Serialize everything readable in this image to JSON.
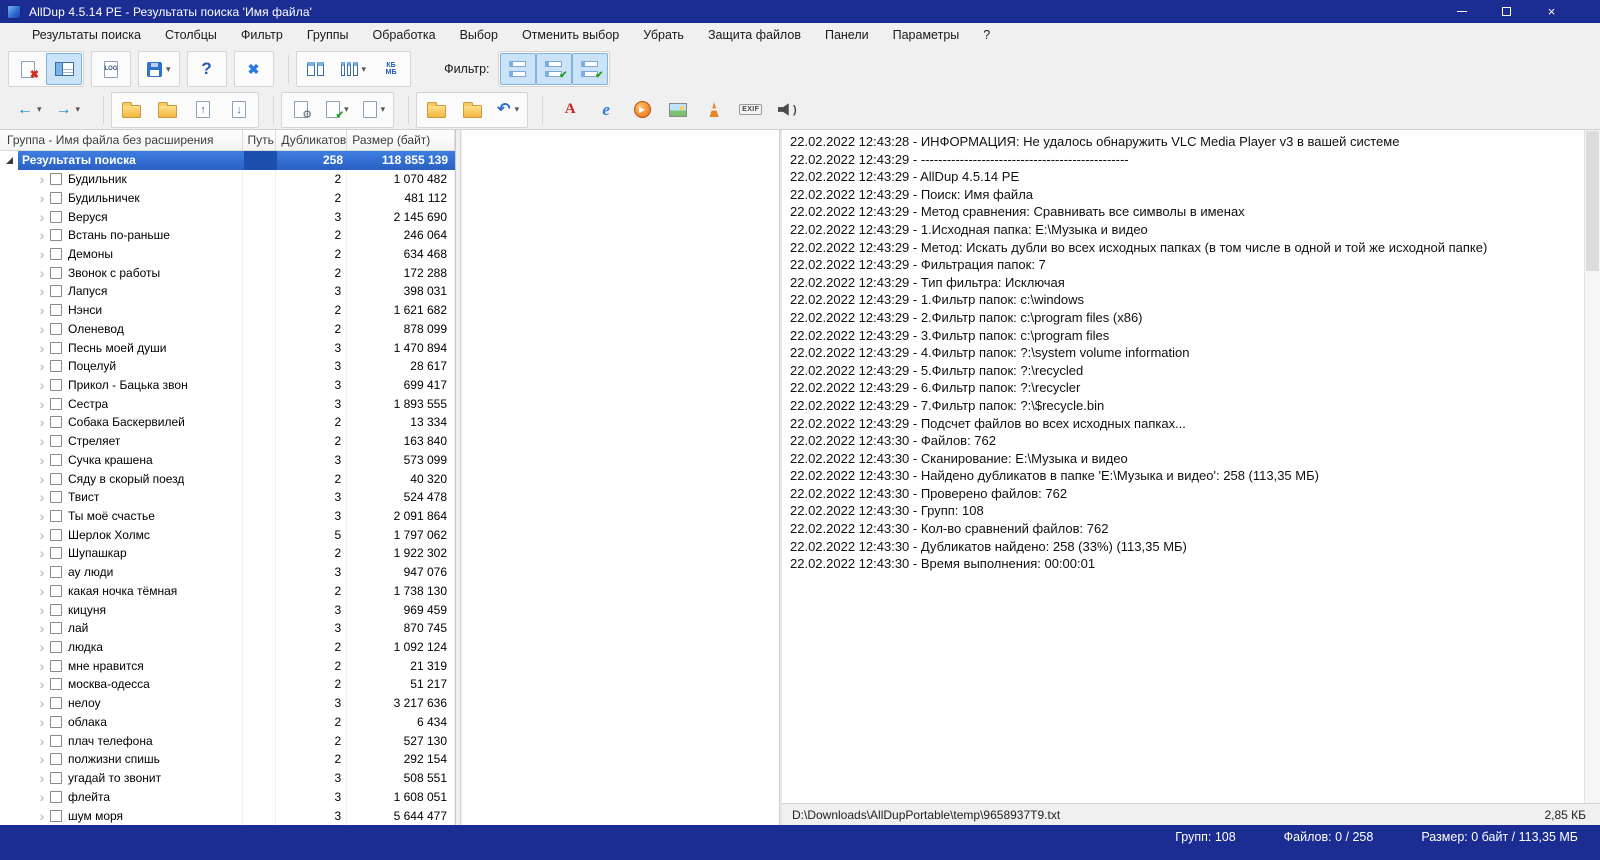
{
  "window": {
    "title": "AllDup 4.5.14 PE - Результаты поиска 'Имя файла'",
    "controls": {
      "close": "×"
    }
  },
  "menu": {
    "items": [
      "Результаты поиска",
      "Столбцы",
      "Фильтр",
      "Группы",
      "Обработка",
      "Выбор",
      "Отменить выбор",
      "Убрать",
      "Защита файлов",
      "Панели",
      "Параметры",
      "?"
    ]
  },
  "toolbar": {
    "filter_label": "Фильтр:"
  },
  "icons": {
    "dropdown": "▾",
    "red_x": "✖",
    "blue_x": "✖",
    "question": "?",
    "log": "LOG",
    "kb": "КБ",
    "mb": "МБ",
    "check": "✔",
    "gear": "⚙",
    "arrow_left": "←",
    "arrow_right": "→",
    "arrow_up": "↑",
    "arrow_down": "↓",
    "undo": "↶",
    "letter_a": "A",
    "letter_e": "e",
    "play": "▶",
    "exif": "EXIF",
    "wave": ")",
    "expander": "›"
  },
  "tree": {
    "columns": [
      "Группа - Имя файла без расширения",
      "Путь",
      "Дубликатов",
      "Размер (байт)"
    ],
    "root": {
      "label": "Результаты поиска",
      "duplicates": "258",
      "size": "118 855 139"
    },
    "rows": [
      {
        "label": "Будильник",
        "duplicates": "2",
        "size": "1 070 482"
      },
      {
        "label": "Будильничек",
        "duplicates": "2",
        "size": "481 112"
      },
      {
        "label": "Веруся",
        "duplicates": "3",
        "size": "2 145 690"
      },
      {
        "label": "Встань по-раньше",
        "duplicates": "2",
        "size": "246 064"
      },
      {
        "label": "Демоны",
        "duplicates": "2",
        "size": "634 468"
      },
      {
        "label": "Звонок с работы",
        "duplicates": "2",
        "size": "172 288"
      },
      {
        "label": "Лапуся",
        "duplicates": "3",
        "size": "398 031"
      },
      {
        "label": "Нэнси",
        "duplicates": "2",
        "size": "1 621 682"
      },
      {
        "label": "Оленевод",
        "duplicates": "2",
        "size": "878 099"
      },
      {
        "label": "Песнь моей души",
        "duplicates": "3",
        "size": "1 470 894"
      },
      {
        "label": "Поцелуй",
        "duplicates": "3",
        "size": "28 617"
      },
      {
        "label": "Прикол - Бацька звон",
        "duplicates": "3",
        "size": "699 417"
      },
      {
        "label": "Сестра",
        "duplicates": "3",
        "size": "1 893 555"
      },
      {
        "label": "Собака Баскервилей",
        "duplicates": "2",
        "size": "13 334"
      },
      {
        "label": "Стреляет",
        "duplicates": "2",
        "size": "163 840"
      },
      {
        "label": "Сучка крашена",
        "duplicates": "3",
        "size": "573 099"
      },
      {
        "label": "Сяду в скорый поезд",
        "duplicates": "2",
        "size": "40 320"
      },
      {
        "label": "Твист",
        "duplicates": "3",
        "size": "524 478"
      },
      {
        "label": "Ты моё счастье",
        "duplicates": "3",
        "size": "2 091 864"
      },
      {
        "label": "Шерлок Холмс",
        "duplicates": "5",
        "size": "1 797 062"
      },
      {
        "label": "Шупашкар",
        "duplicates": "2",
        "size": "1 922 302"
      },
      {
        "label": "ау люди",
        "duplicates": "3",
        "size": "947 076"
      },
      {
        "label": "какая ночка тёмная",
        "duplicates": "2",
        "size": "1 738 130"
      },
      {
        "label": "кицуня",
        "duplicates": "3",
        "size": "969 459"
      },
      {
        "label": "лай",
        "duplicates": "3",
        "size": "870 745"
      },
      {
        "label": "людка",
        "duplicates": "2",
        "size": "1 092 124"
      },
      {
        "label": "мне нравится",
        "duplicates": "2",
        "size": "21 319"
      },
      {
        "label": "москва-одесса",
        "duplicates": "2",
        "size": "51 217"
      },
      {
        "label": "нелоу",
        "duplicates": "3",
        "size": "3 217 636"
      },
      {
        "label": "облака",
        "duplicates": "2",
        "size": "6 434"
      },
      {
        "label": "плач телефона",
        "duplicates": "2",
        "size": "527 130"
      },
      {
        "label": "полжизни спишь",
        "duplicates": "2",
        "size": "292 154"
      },
      {
        "label": "угадай то звонит",
        "duplicates": "3",
        "size": "508 551"
      },
      {
        "label": "флейта",
        "duplicates": "3",
        "size": "1 608 051"
      },
      {
        "label": "шум моря",
        "duplicates": "3",
        "size": "5 644 477"
      }
    ]
  },
  "log": {
    "lines": [
      "22.02.2022 12:43:28 - ИНФОРМАЦИЯ: Не удалось обнаружить VLC Media Player v3 в вашей системе",
      "22.02.2022 12:43:29 - ------------------------------------------------",
      "22.02.2022 12:43:29 - AllDup 4.5.14 PE",
      "22.02.2022 12:43:29 - Поиск: Имя файла",
      "22.02.2022 12:43:29 - Метод сравнения: Сравнивать все символы в именах",
      "22.02.2022 12:43:29 - 1.Исходная папка: E:\\Музыка и видео",
      "22.02.2022 12:43:29 - Метод: Искать дубли во всех исходных папках (в том числе в одной и той же исходной папке)",
      "22.02.2022 12:43:29 - Фильтрация папок: 7",
      "22.02.2022 12:43:29 - Тип фильтра: Исключая",
      "22.02.2022 12:43:29 - 1.Фильтр папок: c:\\windows",
      "22.02.2022 12:43:29 - 2.Фильтр папок: c:\\program files (x86)",
      "22.02.2022 12:43:29 - 3.Фильтр папок: c:\\program files",
      "22.02.2022 12:43:29 - 4.Фильтр папок: ?:\\system volume information",
      "22.02.2022 12:43:29 - 5.Фильтр папок: ?:\\recycled",
      "22.02.2022 12:43:29 - 6.Фильтр папок: ?:\\recycler",
      "22.02.2022 12:43:29 - 7.Фильтр папок: ?:\\$recycle.bin",
      "22.02.2022 12:43:29 - Подсчет файлов во всех исходных папках...",
      "22.02.2022 12:43:30 - Файлов: 762",
      "22.02.2022 12:43:30 - Сканирование: E:\\Музыка и видео",
      "22.02.2022 12:43:30 - Найдено дубликатов в папке 'E:\\Музыка и видео': 258 (113,35 МБ)",
      "22.02.2022 12:43:30 - Проверено файлов: 762",
      "22.02.2022 12:43:30 - Групп: 108",
      "22.02.2022 12:43:30 - Кол-во сравнений файлов: 762",
      "22.02.2022 12:43:30 - Дубликатов найдено: 258 (33%) (113,35 МБ)",
      "22.02.2022 12:43:30 - Время выполнения: 00:00:01"
    ],
    "file_path": "D:\\Downloads\\AllDupPortable\\temp\\9658937T9.txt",
    "file_size": "2,85 КБ"
  },
  "statusbar": {
    "groups": "Групп: 108",
    "files": "Файлов: 0 / 258",
    "size": "Размер: 0 байт / 113,35 МБ"
  }
}
